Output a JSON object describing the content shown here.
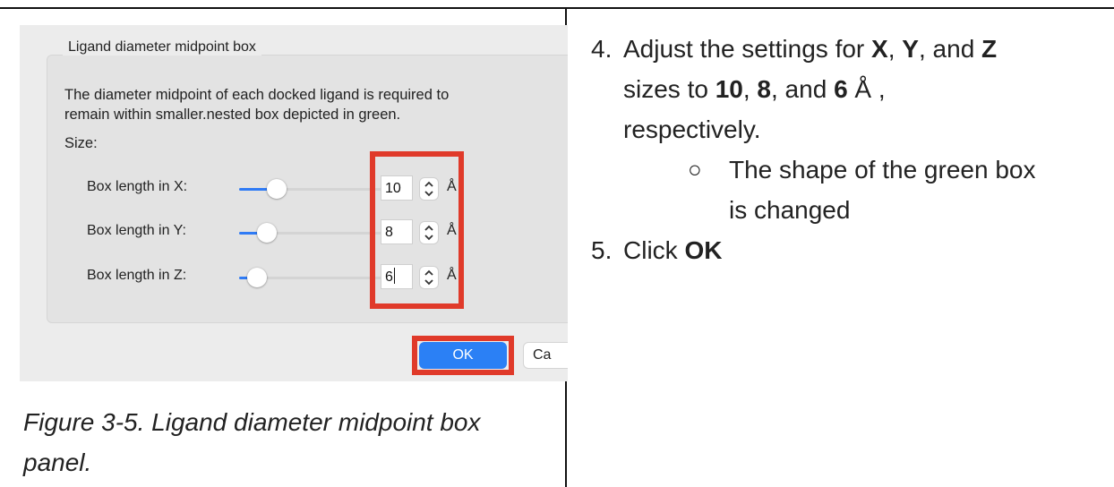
{
  "dialog": {
    "group_title": "Ligand diameter midpoint box",
    "description_line1": "The diameter midpoint of each docked ligand is required to",
    "description_line2": "remain within smaller.nested box depicted in green.",
    "size_label": "Size:",
    "rows": [
      {
        "label": "Box length in X:",
        "value": "10",
        "unit": "Å",
        "slider_fraction": 0.2
      },
      {
        "label": "Box length in Y:",
        "value": "8",
        "unit": "Å",
        "slider_fraction": 0.13
      },
      {
        "label": "Box length in Z:",
        "value": "6",
        "unit": "Å",
        "slider_fraction": 0.06
      }
    ],
    "ok_label": "OK",
    "cancel_label": "Ca",
    "highlight_color": "#e03a2a",
    "accent_color": "#2b80f5"
  },
  "caption": {
    "line1": "Figure 3-5. Ligand diameter midpoint box",
    "line2": "panel."
  },
  "instructions": {
    "step4": {
      "number": "4.",
      "line1_pre": "Adjust the settings for ",
      "x": "X",
      "sep1": ", ",
      "y": "Y",
      "sep2": ", and ",
      "z": "Z",
      "line2_pre": "sizes to ",
      "v10": "10",
      "sep3": ", ",
      "v8": "8",
      "sep4": ", and ",
      "v6": "6",
      "unit": " Å ,",
      "line3": "respectively.",
      "sub_bullet": "○",
      "sub_line1": "The shape of the green box",
      "sub_line2": "is changed"
    },
    "step5": {
      "number": "5.",
      "text": "Click ",
      "bold": "OK"
    }
  }
}
